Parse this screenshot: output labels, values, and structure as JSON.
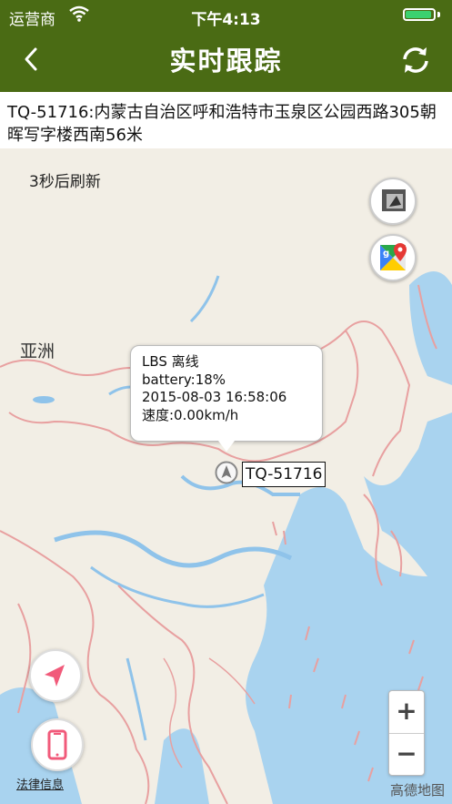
{
  "status_bar": {
    "carrier": "运营商",
    "time": "下午4:13"
  },
  "header": {
    "title": "实时跟踪"
  },
  "address": {
    "text": "TQ-51716:内蒙古自治区呼和浩特市玉泉区公园西路305朝晖写字楼西南56米"
  },
  "map": {
    "refresh_text": "3秒后刷新",
    "region_label": "亚洲",
    "info_window": {
      "line1": "LBS 离线",
      "line2": "battery:18%",
      "line3": "2015-08-03 16:58:06",
      "line4": "速度:0.00km/h"
    },
    "device_label": "TQ-51716",
    "legal_link": "法律信息",
    "zoom_in": "+",
    "zoom_out": "−",
    "brand": "高德地图"
  },
  "colors": {
    "header_bg": "#4a6b14",
    "water": "#a9d3ef",
    "border": "#e8a0a0",
    "pin": "#f15a7a"
  }
}
